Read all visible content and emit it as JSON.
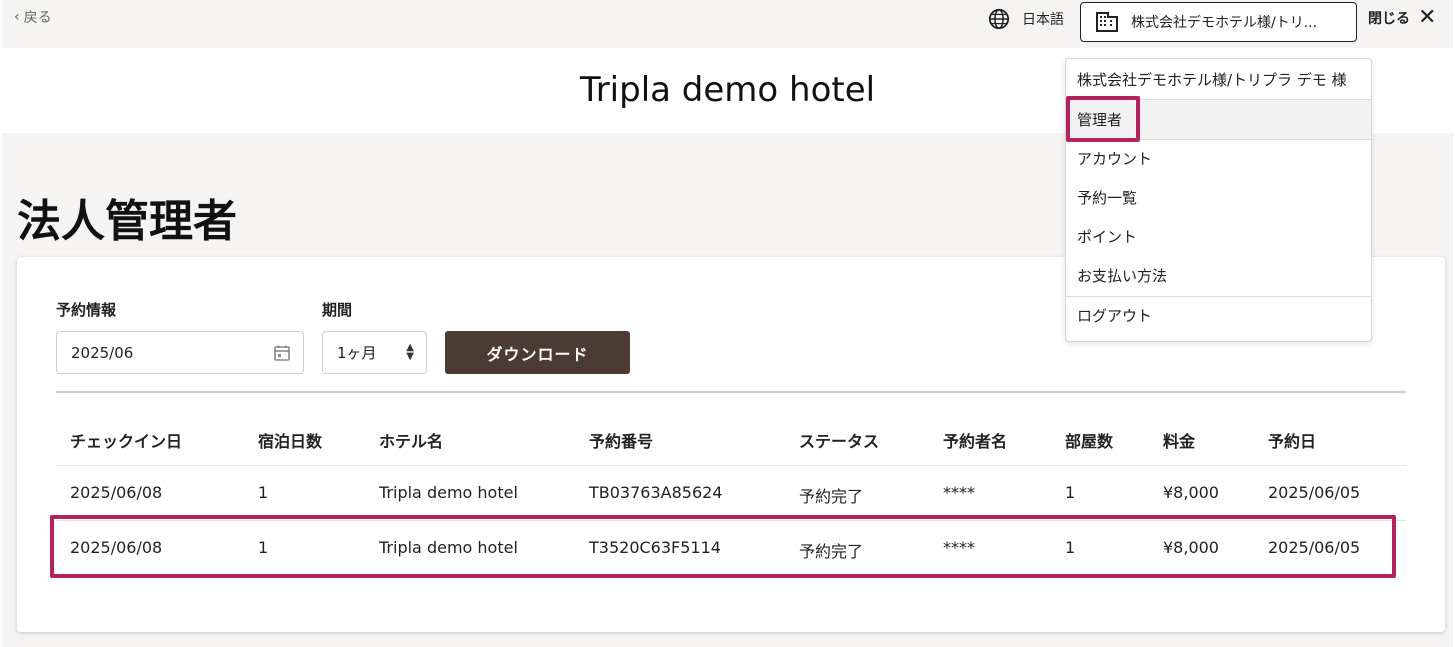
{
  "header": {
    "back_label": "戻る",
    "language_label": "日本語",
    "account_label": "株式会社デモホテル様/トリ...",
    "close_label": "閉じる",
    "hotel_title": "Tripla demo hotel"
  },
  "page": {
    "heading": "法人管理者"
  },
  "filters": {
    "reservation_label": "予約情報",
    "reservation_value": "2025/06",
    "period_label": "期間",
    "period_value": "1ヶ月",
    "download_label": "ダウンロード"
  },
  "table": {
    "headers": [
      "チェックイン日",
      "宿泊日数",
      "ホテル名",
      "予約番号",
      "ステータス",
      "予約者名",
      "部屋数",
      "料金",
      "予約日"
    ],
    "rows": [
      [
        "2025/06/08",
        "1",
        "Tripla demo hotel",
        "TB03763A85624",
        "予約完了",
        "****",
        "1",
        "¥8,000",
        "2025/06/05"
      ],
      [
        "2025/06/08",
        "1",
        "Tripla demo hotel",
        "T3520C63F5114",
        "予約完了",
        "****",
        "1",
        "¥8,000",
        "2025/06/05"
      ]
    ]
  },
  "menu": {
    "company": "株式会社デモホテル様/トリプラ デモ 様",
    "items": [
      "管理者",
      "アカウント",
      "予約一覧",
      "ポイント",
      "お支払い方法"
    ],
    "logout": "ログアウト"
  },
  "colors": {
    "highlight": "#b3245c",
    "button": "#4a3c33",
    "background": "#f5f4f2"
  }
}
